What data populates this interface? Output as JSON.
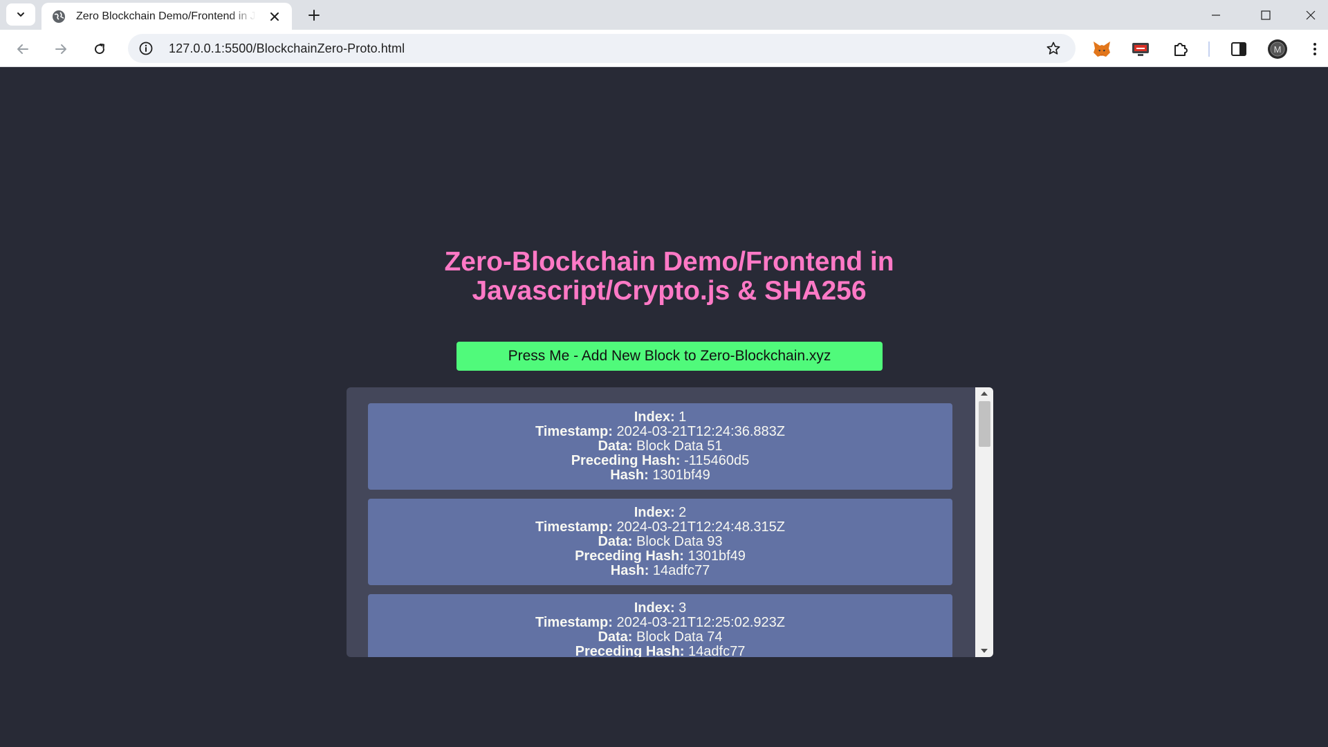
{
  "browser": {
    "tab_title": "Zero Blockchain Demo/Frontend in Javascript/Crypto.js & SHA256",
    "url": "127.0.0.1:5500/BlockchainZero-Proto.html",
    "extensions": [
      "metamask-fox-icon",
      "screen-reader-icon",
      "puzzle-extensions-icon"
    ],
    "profile_initial": "M"
  },
  "page": {
    "title": "Zero-Blockchain Demo/Frontend in Javascript/Crypto.js & SHA256",
    "add_button_label": "Press Me - Add New Block to Zero-Blockchain.xyz",
    "labels": {
      "index": "Index:",
      "timestamp": "Timestamp:",
      "data": "Data:",
      "preceding_hash": "Preceding Hash:",
      "hash": "Hash:"
    },
    "blocks": [
      {
        "index": "1",
        "timestamp": "2024-03-21T12:24:36.883Z",
        "data": "Block Data 51",
        "preceding_hash": "-115460d5",
        "hash": "1301bf49"
      },
      {
        "index": "2",
        "timestamp": "2024-03-21T12:24:48.315Z",
        "data": "Block Data 93",
        "preceding_hash": "1301bf49",
        "hash": "14adfc77"
      },
      {
        "index": "3",
        "timestamp": "2024-03-21T12:25:02.923Z",
        "data": "Block Data 74",
        "preceding_hash": "14adfc77",
        "hash": ""
      }
    ]
  },
  "colors": {
    "background": "#282a36",
    "title": "#ff79c6",
    "button": "#50fa7b",
    "chain_panel": "#44475a",
    "block": "#6272a4"
  }
}
